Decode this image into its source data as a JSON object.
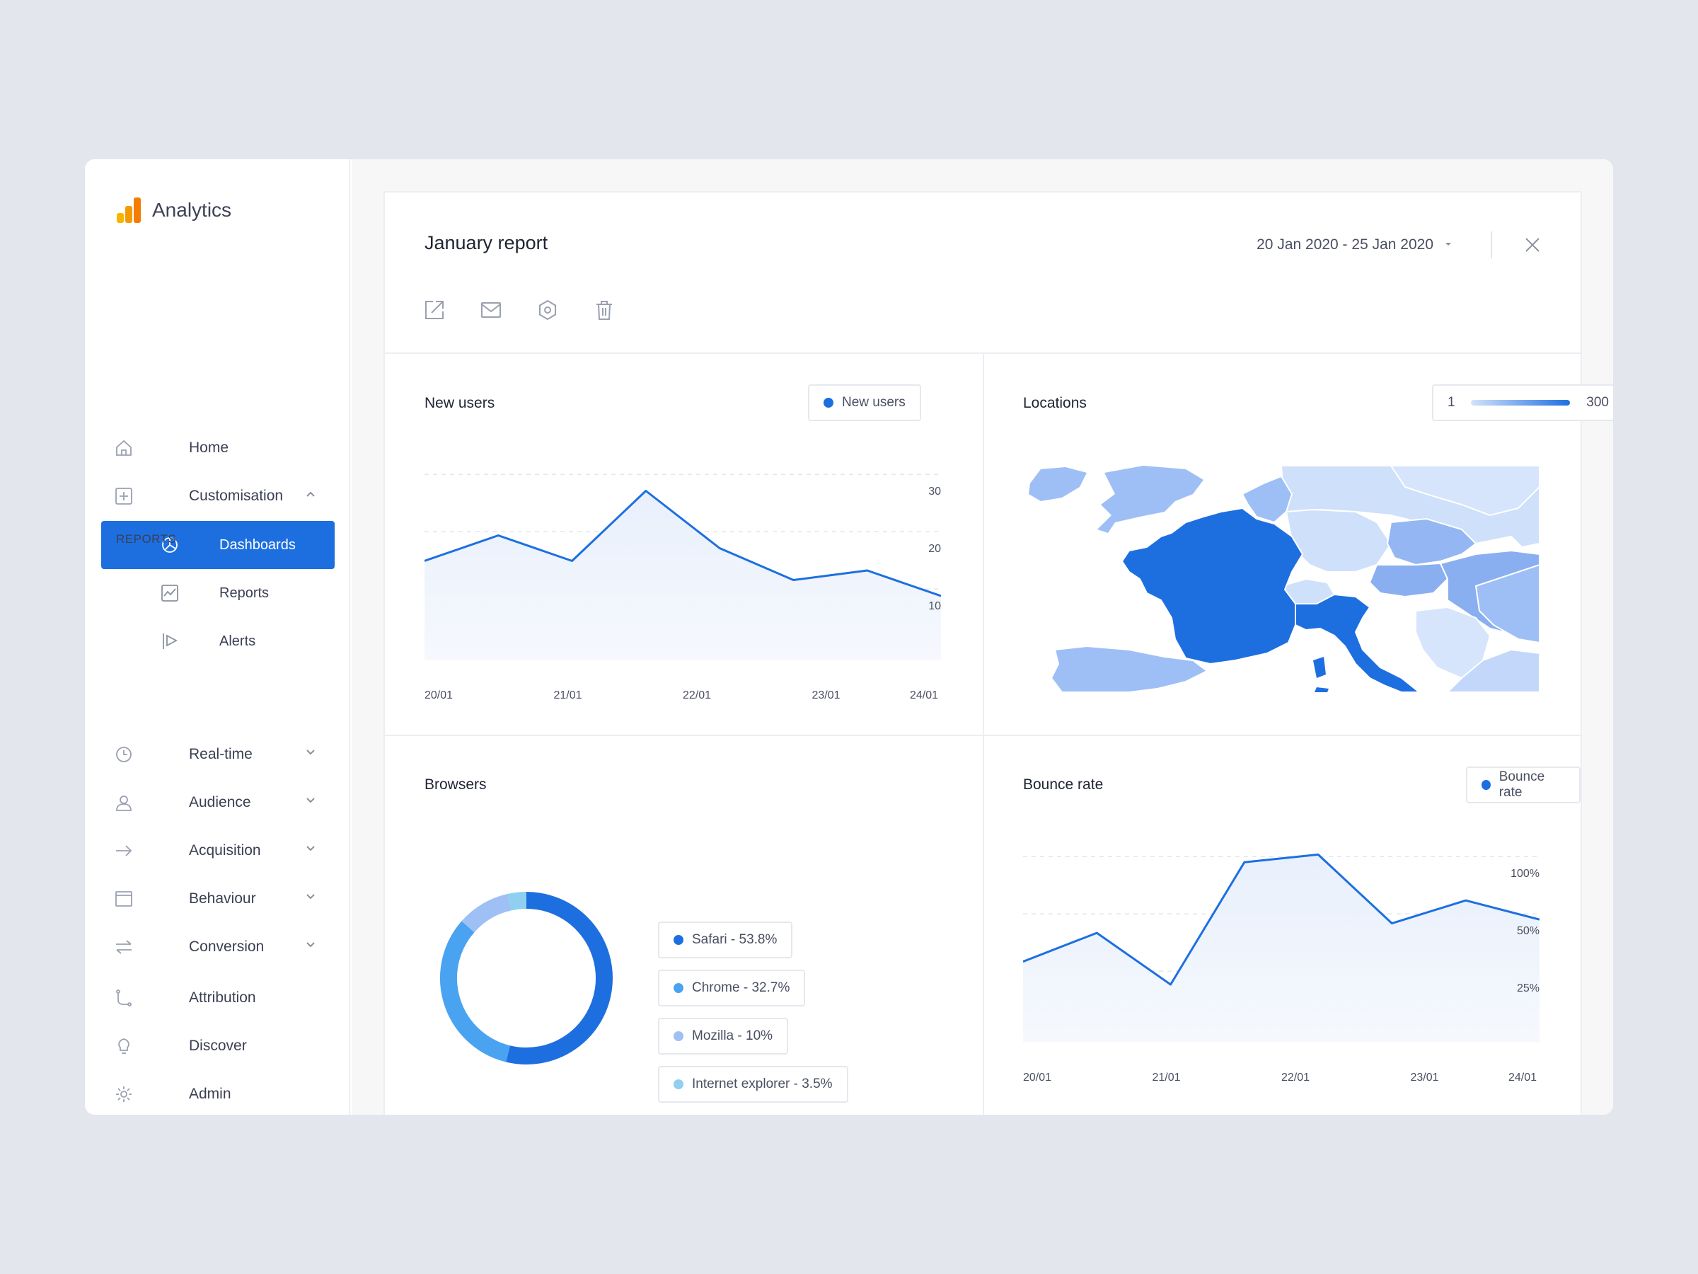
{
  "app": {
    "title": "Analytics"
  },
  "sidebar": {
    "home": "Home",
    "customisation": "Customisation",
    "sub": [
      "Dashboards",
      "Reports",
      "Alerts"
    ],
    "reports_section": "REPORTS",
    "reports": [
      "Real-time",
      "Audience",
      "Acquisition",
      "Behaviour",
      "Conversion"
    ],
    "bottom": [
      "Attribution",
      "Discover",
      "Admin"
    ]
  },
  "report": {
    "title": "January report",
    "date_range": "20 Jan 2020 - 25 Jan 2020"
  },
  "panels": {
    "new_users": {
      "title": "New users",
      "legend": "New users"
    },
    "locations": {
      "title": "Locations",
      "scale_min": "1",
      "scale_max": "300"
    },
    "browsers": {
      "title": "Browsers"
    },
    "bounce_rate": {
      "title": "Bounce rate",
      "legend": "Bounce rate"
    }
  },
  "colors": {
    "accent": "#1d6fe0",
    "light": "#4aa3f0",
    "lighter": "#9ec0f5",
    "lightest": "#8fd0f0"
  },
  "chart_data": [
    {
      "type": "area",
      "title": "New users",
      "x": [
        "20/01",
        "",
        "21/01",
        "",
        "22/01",
        "",
        "23/01",
        "",
        "24/01"
      ],
      "x_ticks": [
        "20/01",
        "21/01",
        "22/01",
        "23/01",
        "24/01"
      ],
      "y_ticks": [
        "30",
        "20",
        "10"
      ],
      "ylim": [
        0,
        30
      ],
      "series": [
        {
          "name": "New users",
          "values": [
            15.5,
            19.5,
            15.5,
            26.5,
            17.5,
            12.5,
            14,
            10
          ]
        }
      ]
    },
    {
      "type": "area",
      "title": "Bounce rate",
      "x_ticks": [
        "20/01",
        "21/01",
        "22/01",
        "23/01",
        "24/01"
      ],
      "y_ticks": [
        "100%",
        "50%",
        "25%"
      ],
      "ylim": [
        0,
        100
      ],
      "series": [
        {
          "name": "Bounce rate",
          "values": [
            42,
            57,
            30,
            94,
            98,
            62,
            74,
            64
          ]
        }
      ]
    },
    {
      "type": "pie",
      "title": "Browsers",
      "series": [
        {
          "name": "Safari - 53.8%",
          "value": 53.8,
          "color": "#1d6fe0"
        },
        {
          "name": "Chrome - 32.7%",
          "value": 32.7,
          "color": "#4aa3f0"
        },
        {
          "name": "Mozilla - 10%",
          "value": 10,
          "color": "#9ec0f5"
        },
        {
          "name": "Internet explorer - 3.5%",
          "value": 3.5,
          "color": "#8fd0f0"
        }
      ]
    }
  ]
}
